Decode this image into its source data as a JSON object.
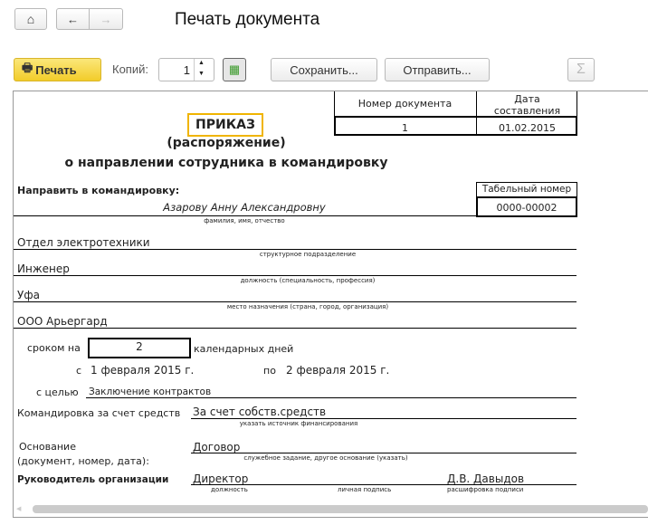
{
  "header": {
    "title": "Печать документа"
  },
  "toolbar": {
    "print_label": "Печать",
    "copies_label": "Копий:",
    "copies_value": "1",
    "save_label": "Сохранить...",
    "send_label": "Отправить...",
    "sum_label": "Σ"
  },
  "document": {
    "table": {
      "doc_number_header": "Номер документа",
      "date_header_1": "Дата",
      "date_header_2": "составления",
      "doc_number": "1",
      "date": "01.02.2015"
    },
    "title": "ПРИКАЗ",
    "subtitle": "(распоряжение)",
    "heading": "о направлении сотрудника в командировку",
    "send_label": "Направить в командировку:",
    "tab_number_header": "Табельный номер",
    "tab_number": "0000-00002",
    "employee": "Азарову Анну Александровну",
    "employee_caption": "фамилия, имя, отчество",
    "department": "Отдел электротехники",
    "department_caption": "структурное подразделение",
    "position": "Инженер",
    "position_caption": "должность (специальность, профессия)",
    "destination": "Уфа",
    "destination_caption": "место назначения (страна, город, организация)",
    "organization": "ООО Арьергард",
    "term_label": "сроком на",
    "term_days": "2",
    "term_unit": "календарных дней",
    "from_label": "с",
    "from_date": "1 февраля 2015 г.",
    "to_label": "по",
    "to_date": "2 февраля 2015 г.",
    "purpose_label": "с целью",
    "purpose": "Заключение контрактов",
    "funding_label": "Командировка за счет средств",
    "funding": "За счет собств.средств",
    "funding_caption": "указать источник финансирования",
    "basis_label_1": "Основание",
    "basis_label_2": "(документ, номер, дата):",
    "basis": "Договор",
    "basis_caption": "служебное задание, другое основание (указать)",
    "head_label": "Руководитель организации",
    "head_position": "Директор",
    "head_name": "Д.В. Давыдов",
    "caption_position": "должность",
    "caption_signature": "личная подпись",
    "caption_name": "расшифровка подписи"
  },
  "colors": {
    "print_button": "#f5d53a",
    "title_box": "#f0b400"
  }
}
